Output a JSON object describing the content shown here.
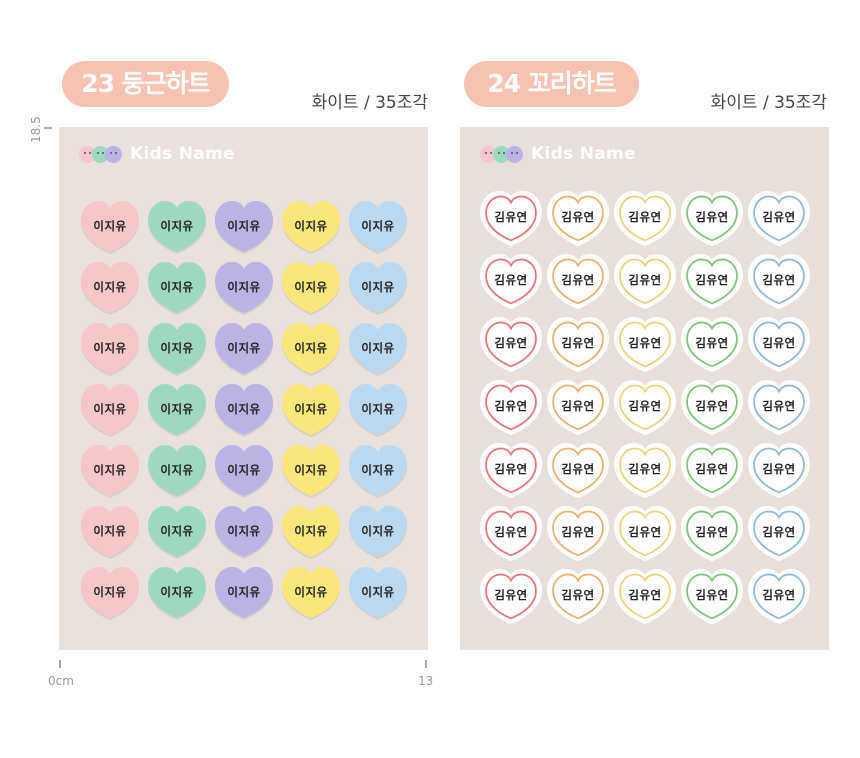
{
  "products": [
    {
      "number_title": "23 둥근하트",
      "spec": "화이트 / 35조각",
      "brand": "Kids Name",
      "sticker_text": "이지유",
      "rows": 7,
      "colors": [
        "#f7c6cb",
        "#9fd8c0",
        "#b9b4e3",
        "#f9e77c",
        "#bcd8ef"
      ]
    },
    {
      "number_title": "24 꼬리하트",
      "spec": "화이트 / 35조각",
      "brand": "Kids Name",
      "sticker_text": "김유연",
      "rows": 7,
      "colors": [
        "#e8727a",
        "#eeae6c",
        "#ecd277",
        "#7fc378",
        "#90b8d6"
      ]
    }
  ],
  "ruler": {
    "height_label": "18.5",
    "start_label": "0cm",
    "end_label": "13"
  },
  "brand_faces": [
    "#f7c6cb",
    "#9fd8c0",
    "#b9b4e3"
  ]
}
